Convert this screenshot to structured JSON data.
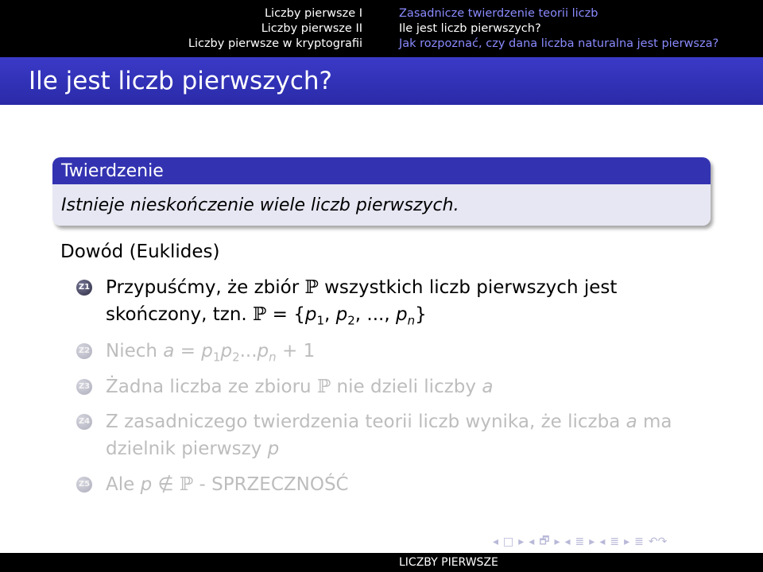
{
  "header": {
    "sections": [
      "Liczby pierwsze I",
      "Liczby pierwsze II",
      "Liczby pierwsze w kryptografii"
    ],
    "subsections": [
      {
        "label": "Zasadnicze twierdzenie teorii liczb",
        "active": false
      },
      {
        "label": "Ile jest liczb pierwszych?",
        "active": true
      },
      {
        "label": "Jak rozpoznać, czy dana liczba naturalna jest pierwsza?",
        "active": false
      }
    ]
  },
  "frame_title": "Ile jest liczb pierwszych?",
  "theorem": {
    "title": "Twierdzenie",
    "body": "Istnieje nieskończenie wiele liczb pierwszych."
  },
  "proof": {
    "title": "Dowód (Euklides)",
    "steps": [
      {
        "marker": "Z1",
        "parts": [
          "Przypuśćmy, że zbiór ",
          "ℙ",
          " wszystkich liczb pierwszych jest skończony, tzn. ",
          "ℙ",
          " = {",
          "p",
          "1",
          ", ",
          "p",
          "2",
          ", ..., ",
          "p",
          "n",
          "}"
        ]
      },
      {
        "marker": "Z2",
        "parts": [
          "Niech ",
          "a",
          " = ",
          "p",
          "1",
          "p",
          "2",
          "...",
          "p",
          "n",
          " + 1"
        ]
      },
      {
        "marker": "Z3",
        "parts": [
          "Żadna liczba ze zbioru ",
          "ℙ",
          " nie dzieli liczby ",
          "a"
        ]
      },
      {
        "marker": "Z4",
        "parts": [
          "Z zasadniczego twierdzenia teorii liczb wynika, że liczba ",
          "a",
          " ma dzielnik pierwszy ",
          "p"
        ]
      },
      {
        "marker": "Z5",
        "parts": [
          "Ale ",
          "p",
          " ∉ ",
          "ℙ",
          " - SPRZECZNOŚĆ"
        ]
      }
    ]
  },
  "nav_symbols": [
    "◂",
    "□",
    "▸",
    "◂",
    "🗗",
    "▸",
    "◂",
    "≣",
    "▸",
    "◂",
    "≣",
    "▸",
    "≣",
    "↶↷"
  ],
  "footer": {
    "title": "LICZBY PIERWSZE"
  }
}
